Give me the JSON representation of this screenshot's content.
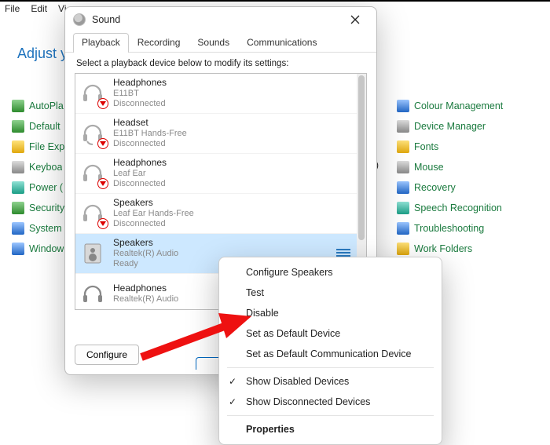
{
  "menubar": {
    "file": "File",
    "edit": "Edit",
    "view": "Vi"
  },
  "cp_heading": "Adjust y",
  "close_paren": ")",
  "cp_left": [
    {
      "label": "AutoPla"
    },
    {
      "label": "Default"
    },
    {
      "label": "File Exp"
    },
    {
      "label": "Keyboa"
    },
    {
      "label": "Power ("
    },
    {
      "label": "Security"
    },
    {
      "label": "System"
    },
    {
      "label": "Window"
    }
  ],
  "cp_right": [
    {
      "label": "Colour Management"
    },
    {
      "label": "Device Manager"
    },
    {
      "label": "Fonts"
    },
    {
      "label": "Mouse"
    },
    {
      "label": "Recovery"
    },
    {
      "label": "Speech Recognition"
    },
    {
      "label": "Troubleshooting"
    },
    {
      "label": "Work Folders"
    }
  ],
  "dialog": {
    "title": "Sound",
    "tabs": {
      "playback": "Playback",
      "recording": "Recording",
      "sounds": "Sounds",
      "communications": "Communications"
    },
    "instruction": "Select a playback device below to modify its settings:",
    "devices": [
      {
        "name": "Headphones",
        "sub1": "E11BT",
        "sub2": "Disconnected",
        "type": "headphones",
        "status": "disc"
      },
      {
        "name": "Headset",
        "sub1": "E11BT Hands-Free",
        "sub2": "Disconnected",
        "type": "headset",
        "status": "disc"
      },
      {
        "name": "Headphones",
        "sub1": "Leaf Ear",
        "sub2": "Disconnected",
        "type": "headphones",
        "status": "disc"
      },
      {
        "name": "Speakers",
        "sub1": "Leaf Ear Hands-Free",
        "sub2": "Disconnected",
        "type": "headphones",
        "status": "disc"
      },
      {
        "name": "Speakers",
        "sub1": "Realtek(R) Audio",
        "sub2": "Ready",
        "type": "speaker",
        "status": "ready",
        "selected": true
      },
      {
        "name": "Headphones",
        "sub1": "Realtek(R) Audio",
        "sub2": "",
        "type": "headphones",
        "status": "none"
      }
    ],
    "buttons": {
      "configure": "Configure"
    }
  },
  "context_menu": {
    "configure": "Configure Speakers",
    "test": "Test",
    "disable": "Disable",
    "set_default": "Set as Default Device",
    "set_default_comm": "Set as Default Communication Device",
    "show_disabled": "Show Disabled Devices",
    "show_disconnected": "Show Disconnected Devices",
    "properties": "Properties"
  }
}
